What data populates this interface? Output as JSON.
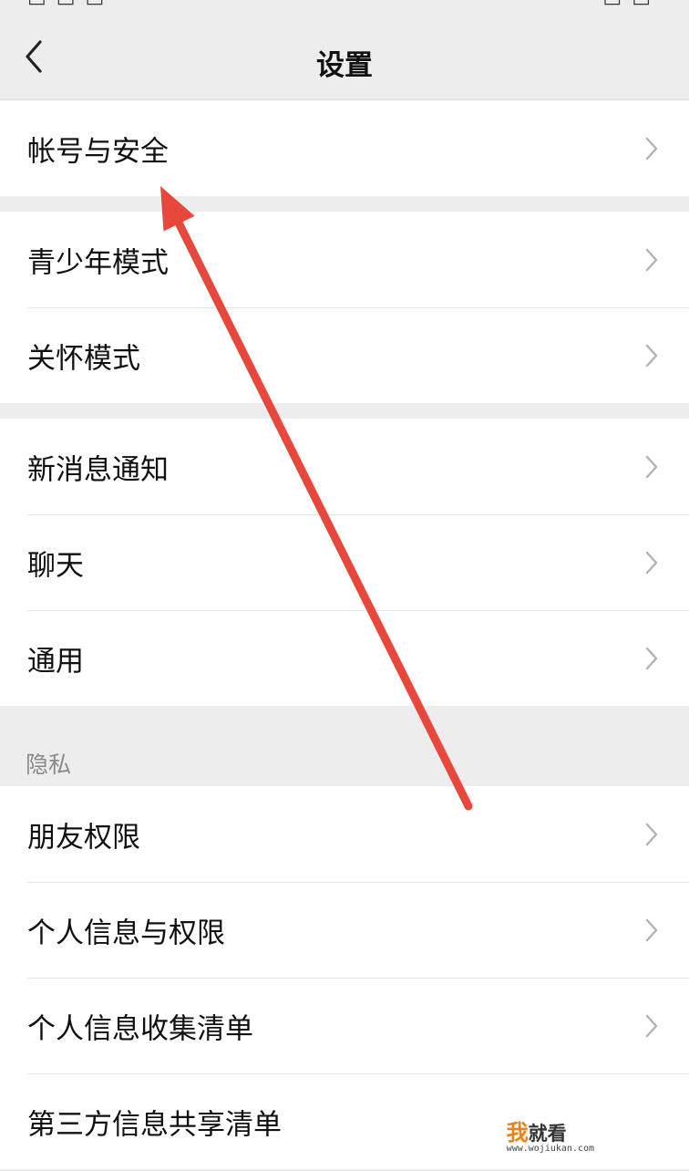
{
  "nav": {
    "title": "设置"
  },
  "groups": [
    {
      "items": [
        {
          "label": "帐号与安全"
        }
      ]
    },
    {
      "items": [
        {
          "label": "青少年模式"
        },
        {
          "label": "关怀模式"
        }
      ]
    },
    {
      "items": [
        {
          "label": "新消息通知"
        },
        {
          "label": "聊天"
        },
        {
          "label": "通用"
        }
      ]
    },
    {
      "items": [
        {
          "label": "朋友权限"
        },
        {
          "label": "个人信息与权限"
        },
        {
          "label": "个人信息收集清单"
        },
        {
          "label": "第三方信息共享清单"
        }
      ]
    }
  ],
  "sections": {
    "privacy_header": "隐私"
  },
  "icons": {
    "back": "chevron-left-icon",
    "row_arrow": "chevron-right-icon"
  },
  "annotation": {
    "arrow_color": "#e8473c"
  },
  "watermark": {
    "title_first": "我",
    "title_rest": "就看",
    "url": "www.wojiukan.com"
  },
  "colors": {
    "background": "#ededed",
    "row_background": "#ffffff",
    "divider": "#e5e5e5",
    "chevron": "#b2b2b2",
    "section_text": "#8a8a8a"
  }
}
